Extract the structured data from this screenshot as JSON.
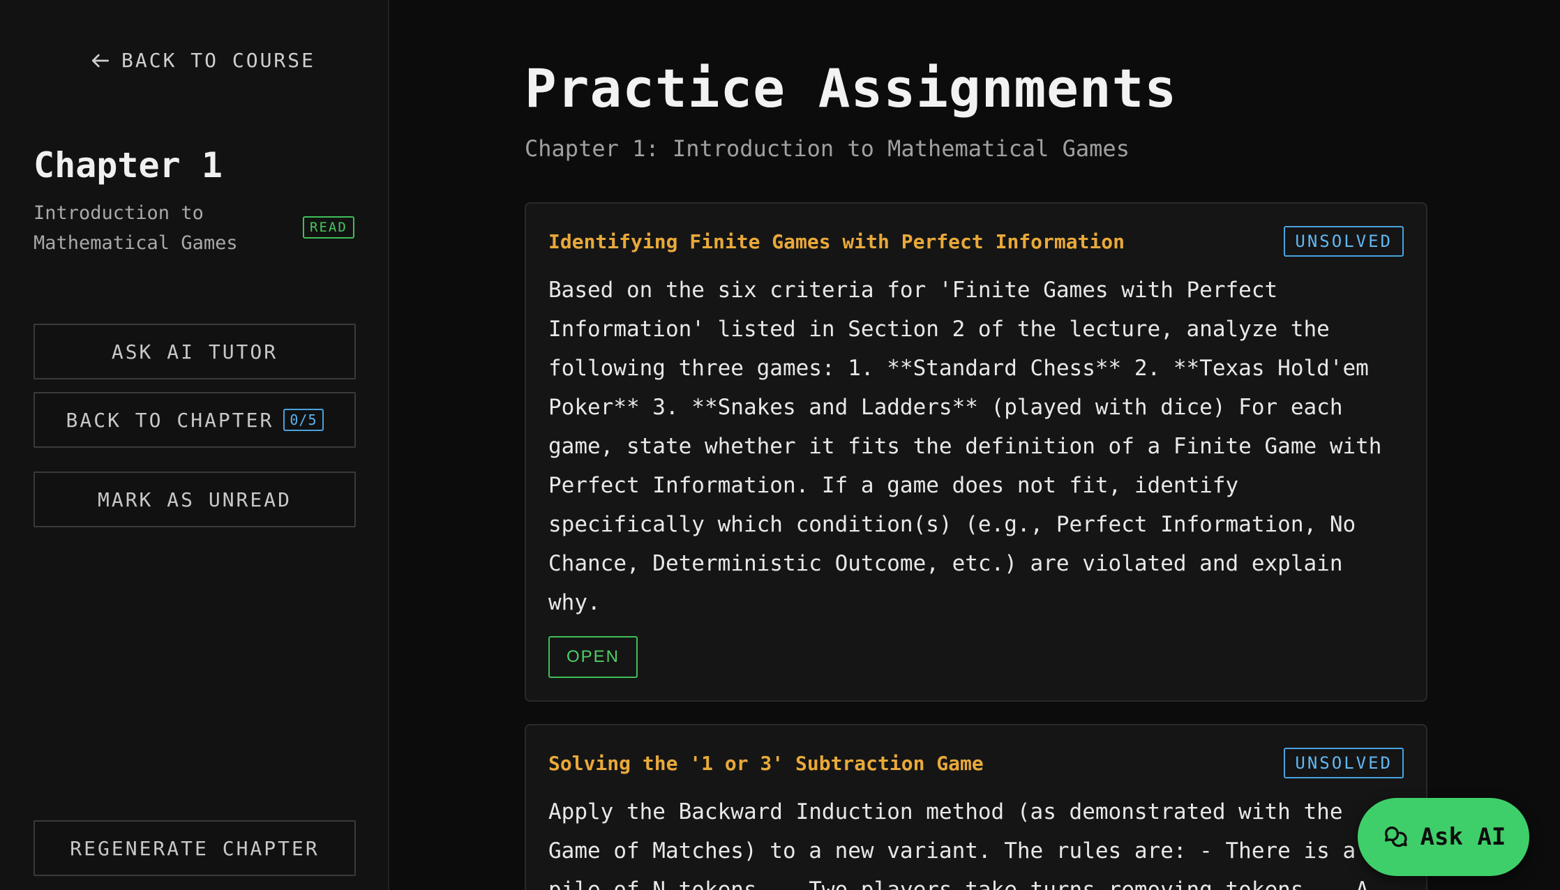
{
  "sidebar": {
    "back_label": "BACK TO COURSE",
    "chapter_title": "Chapter 1",
    "chapter_subtitle": "Introduction to Mathematical Games",
    "read_badge": "READ",
    "ask_tutor_label": "ASK AI TUTOR",
    "back_chapter_label": "BACK TO CHAPTER",
    "progress": "0/5",
    "mark_unread_label": "MARK AS UNREAD",
    "regenerate_label": "REGENERATE CHAPTER"
  },
  "main": {
    "title": "Practice Assignments",
    "subtitle": "Chapter 1: Introduction to Mathematical Games",
    "assignments": [
      {
        "title": "Identifying Finite Games with Perfect Information",
        "status": "UNSOLVED",
        "body": "Based on the six criteria for 'Finite Games with Perfect Information' listed in Section 2 of the lecture, analyze the following three games: 1. **Standard Chess** 2. **Texas Hold'em Poker** 3. **Snakes and Ladders** (played with dice) For each game, state whether it fits the definition of a Finite Game with Perfect Information. If a game does not fit, identify specifically which condition(s) (e.g., Perfect Information, No Chance, Deterministic Outcome, etc.) are violated and explain why.",
        "open_label": "OPEN"
      },
      {
        "title": "Solving the '1 or 3' Subtraction Game",
        "status": "UNSOLVED",
        "body": "Apply the Backward Induction method (as demonstrated with the Game of Matches) to a new variant. The rules are: - There is a pile of N tokens. - Two players take turns removing tokens. - A"
      }
    ]
  },
  "fab": {
    "label": "Ask AI"
  },
  "colors": {
    "accent_green": "#3fcf6a",
    "title_orange": "#e9a93a",
    "badge_blue": "#4aa3e0"
  }
}
